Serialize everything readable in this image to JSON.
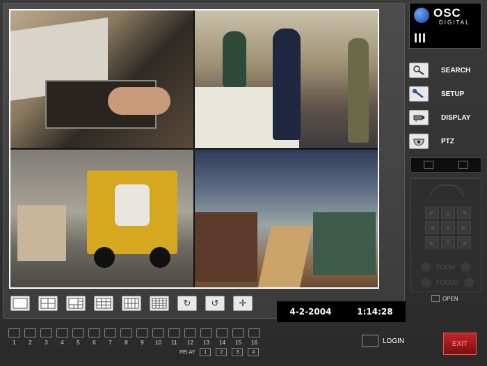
{
  "logo": {
    "brand": "OSC",
    "sub": "DIGITAL",
    "bars": "III"
  },
  "menu": [
    {
      "label": "SEARCH",
      "icon": "magnifier-icon"
    },
    {
      "label": "SETUP",
      "icon": "wrench-icon"
    },
    {
      "label": "DISPLAY",
      "icon": "camera-icon"
    },
    {
      "label": "PTZ",
      "icon": "dome-camera-icon"
    }
  ],
  "datetime": {
    "date": "4-2-2004",
    "time": "1:14:28"
  },
  "ptz": {
    "zoom": "ZOOM",
    "focus": "FOCUS",
    "open": "OPEN"
  },
  "channels": [
    "1",
    "2",
    "3",
    "4",
    "5",
    "6",
    "7",
    "8",
    "9",
    "10",
    "11",
    "12",
    "13",
    "14",
    "15",
    "16"
  ],
  "relay": {
    "label": "RELAY",
    "items": [
      "1",
      "2",
      "3",
      "4"
    ]
  },
  "login": "LOGIN",
  "exit": "EXIT"
}
